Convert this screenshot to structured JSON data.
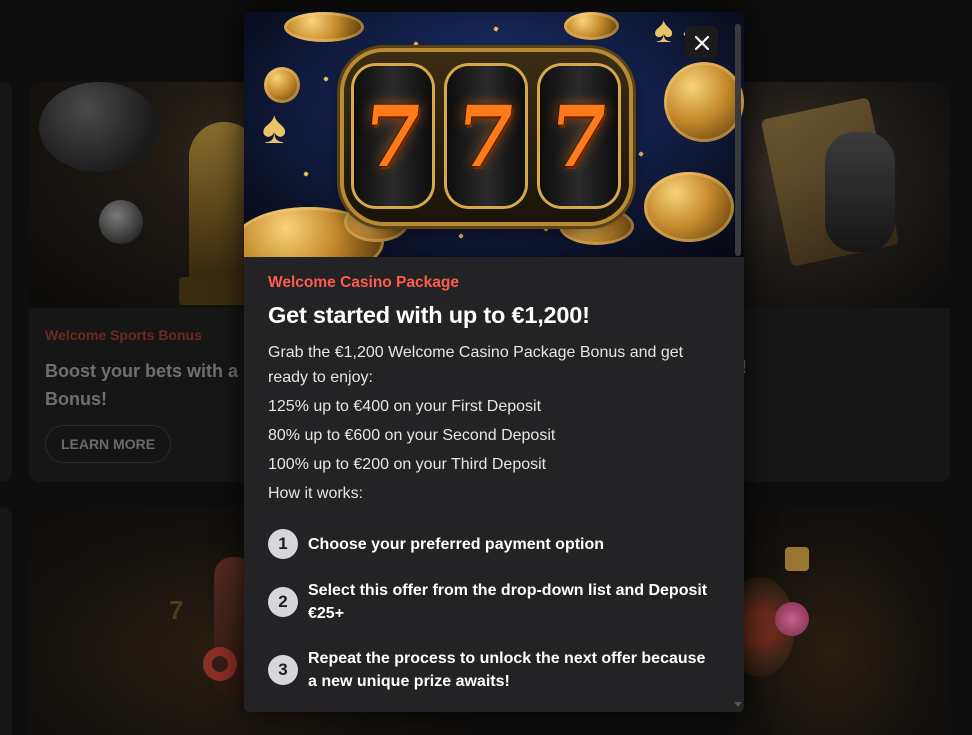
{
  "background": {
    "sports_card": {
      "label": "Welcome Sports Bonus",
      "title": "Boost your bets with a 1 Bonus!",
      "button": "LEARN MORE"
    },
    "right_card": {
      "title_tail": "!"
    },
    "casino_card": {
      "deco_digit": "7"
    }
  },
  "modal": {
    "hero_reels": [
      "7",
      "7",
      "7"
    ],
    "close_label": "×",
    "eyebrow": "Welcome Casino Package",
    "headline": "Get started with up to €1,200!",
    "description": "Grab the €1,200 Welcome Casino Package Bonus and get ready to enjoy:",
    "offers": [
      "125% up to €400 on your First Deposit",
      "80% up to €600 on your Second Deposit",
      "100% up to €200 on your Third Deposit"
    ],
    "how_it_works": "How it works:",
    "steps": [
      {
        "num": "1",
        "text": "Choose your preferred payment option"
      },
      {
        "num": "2",
        "text": "Select this offer from the drop-down list and Deposit €25+"
      },
      {
        "num": "3",
        "text": "Repeat the process to unlock the next offer because a new unique prize awaits!"
      }
    ]
  },
  "colors": {
    "accent_red": "#ff5b4f",
    "modal_bg": "#232325",
    "step_badge": "#d7d7d9",
    "slot_seven": "#ff7a1a"
  },
  "icons": {
    "close": "close-icon",
    "spade": "spade-icon",
    "coin": "coin-icon"
  }
}
